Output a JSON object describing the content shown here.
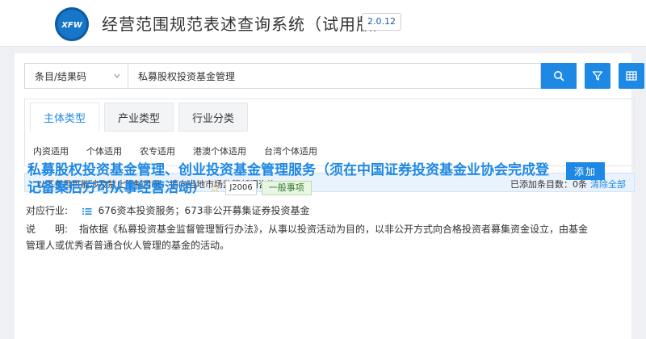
{
  "header": {
    "logo_text": "XFW",
    "title": "经营范围规范表述查询系统（试用版）",
    "version": "2.0.12"
  },
  "search": {
    "select_value": "条目/结果码",
    "query": "私募股权投资基金管理",
    "icons": {
      "search": "search-icon",
      "filter": "filter-icon",
      "table": "table-icon"
    }
  },
  "tabs": [
    {
      "label": "主体类型",
      "active": true
    },
    {
      "label": "产业类型",
      "active": false
    },
    {
      "label": "行业分类",
      "active": false
    }
  ],
  "subtypes": [
    "内资适用",
    "个体适用",
    "农专适用",
    "港澳个体适用",
    "台湾个体适用"
  ],
  "notice": {
    "text": "以下条目可能涉及禁止限制目录，请向当地市场监管部门咨询。",
    "added_label": "已添加条目数：",
    "added_count": "0条",
    "clear_label": "清除全部"
  },
  "result": {
    "title": "私募股权投资基金管理、创业投资基金管理服务（须在中国证券投资基金业协会完成登记备案后方可从事经营活动）",
    "code": "J2006",
    "type": "一般事项",
    "add_label": "添加",
    "industry_label": "对应行业:",
    "industry_value": "676资本投资服务；673非公开募集证券投资基金",
    "desc_label": "说　　明:",
    "desc_text": "指依据《私募投资基金监督管理暂行办法》，从事以投资活动为目的，以非公开方式向合格投资者募集资金设立，由基金管理人或优秀者普通合伙人管理的基金的活动。"
  },
  "colors": {
    "accent": "#1e88e5",
    "notice_bg": "#eaf3fc",
    "tag_green": "#2f7a2f",
    "star": "#f2b531"
  }
}
